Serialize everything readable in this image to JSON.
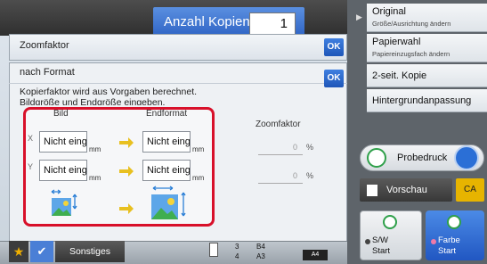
{
  "header": {
    "copies_label": "Anzahl Kopien",
    "copies_value": "1"
  },
  "zoom": {
    "title": "Zoomfaktor",
    "ok": "OK"
  },
  "panel": {
    "format_label": "nach Format",
    "ok": "OK",
    "desc_line1": "Kopierfaktor wird aus Vorgaben berechnet.",
    "desc_line2": "Bildgröße und Endgröße eingeben.",
    "col_bild": "Bild",
    "col_end": "Endformat",
    "axis_x": "X",
    "axis_y": "Y",
    "x_src": "Nicht eing",
    "y_src": "Nicht eing",
    "x_dst": "Nicht eing",
    "y_dst": "Nicht eing",
    "unit": "mm",
    "zoom_col": "Zoomfaktor",
    "zoom_x": "0",
    "zoom_y": "0",
    "pct": "%"
  },
  "bottom": {
    "sonstiges": "Sonstiges",
    "slot1_num": "3",
    "slot1_size": "B4",
    "slot2_num": "4",
    "slot2_size": "A3",
    "slot_a4": "A4"
  },
  "sidebar": {
    "original_title": "Original",
    "original_sub": "Größe/Ausrichtung ändern",
    "papier_title": "Papierwahl",
    "papier_sub": "Papiereinzugsfach ändern",
    "seit": "2-seit. Kopie",
    "hintergrund": "Hintergrundanpassung",
    "probedruck": "Probedruck",
    "vorschau": "Vorschau",
    "ca": "CA",
    "sw_label": "S/W",
    "sw_start": "Start",
    "farbe_label": "Farbe",
    "farbe_start": "Start"
  },
  "colors": {
    "accent_blue": "#2e63c4",
    "highlight_red": "#d8102a",
    "arrow_yellow": "#e8c020",
    "ca_yellow": "#e7b400"
  },
  "icons": {
    "arrow": "yellow-right-arrow-icon",
    "image_src": "image-resize-small-icon",
    "image_dst": "image-resize-large-icon",
    "star": "star-icon",
    "check": "checkmark-icon",
    "vorschau": "preview-icon"
  }
}
